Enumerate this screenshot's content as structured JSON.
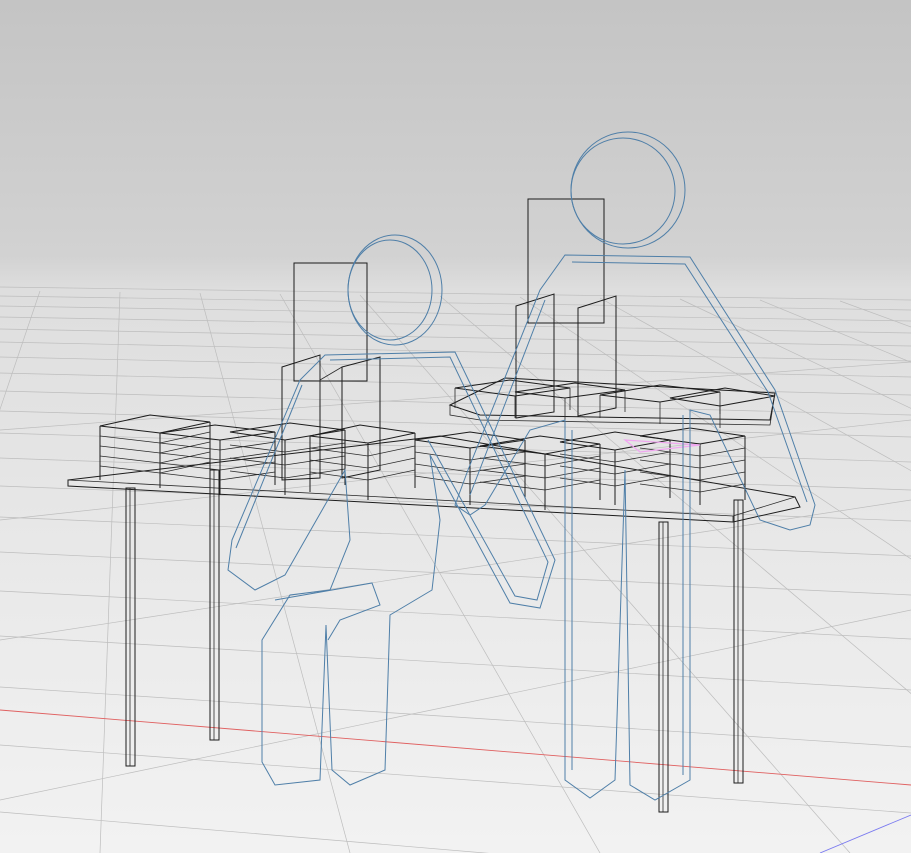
{
  "viewport": {
    "background_top": "#c4c4c4",
    "background_bottom": "#f2f2f2",
    "grid_color": "#bdbdbd",
    "x_axis_color": "#e06060",
    "y_axis_color": "#7a7af0",
    "wire_color": "#1c1c1c",
    "figure_color": "#4f7fa8",
    "highlight_color": "#f0a6f0"
  },
  "scene": {
    "objects": [
      {
        "name": "workbench-table",
        "kind": "table-wireframe"
      },
      {
        "name": "human-figure-seated",
        "kind": "scale-figure"
      },
      {
        "name": "human-figure-standing",
        "kind": "scale-figure"
      },
      {
        "name": "monitor-panel-left",
        "kind": "panel"
      },
      {
        "name": "monitor-panel-right",
        "kind": "panel"
      },
      {
        "name": "storage-bins",
        "kind": "shelving"
      }
    ]
  }
}
